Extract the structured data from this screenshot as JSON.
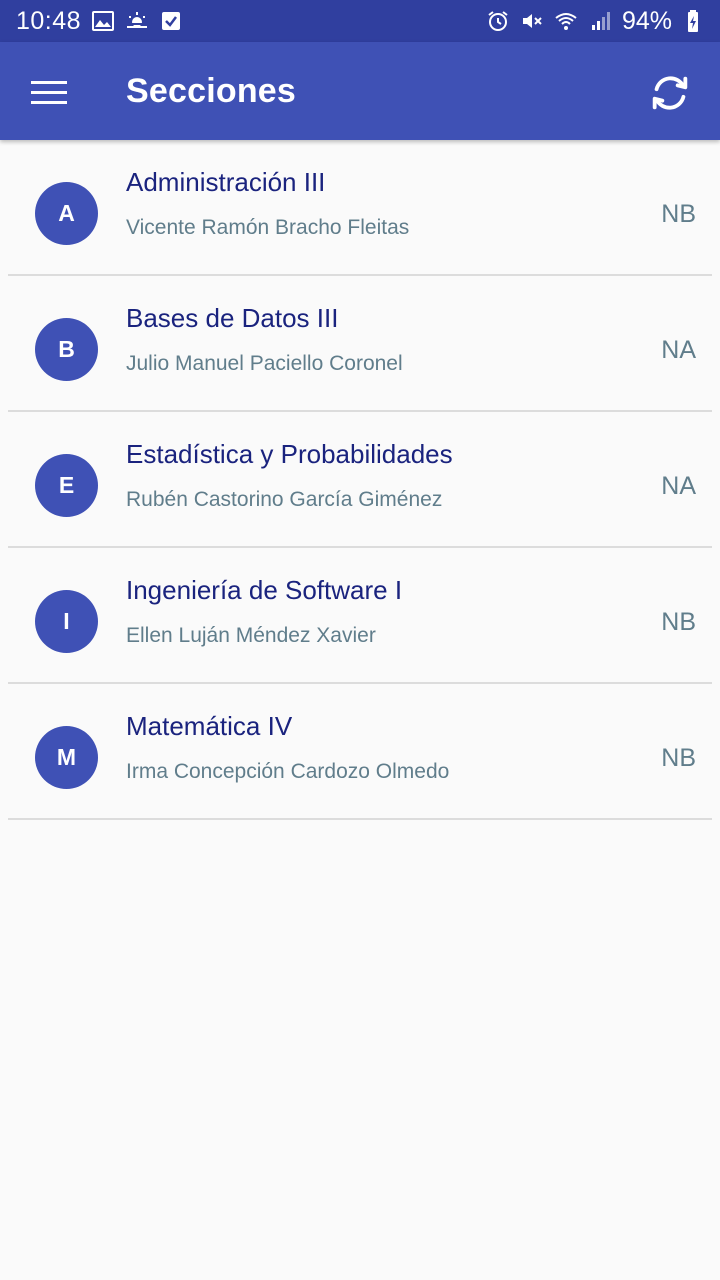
{
  "status_bar": {
    "time": "10:48",
    "battery": "94%",
    "left_icons": [
      "image-icon",
      "weather-icon",
      "checkbox-icon"
    ],
    "right_icons": [
      "alarm-icon",
      "mute-icon",
      "wifi-icon",
      "signal-icon",
      "battery-charging-icon"
    ]
  },
  "app_bar": {
    "title": "Secciones",
    "menu_icon": "hamburger-menu-icon",
    "refresh_icon": "refresh-icon",
    "color": "#3f51b5"
  },
  "colors": {
    "status_bar": "#303f9f",
    "primary": "#3f51b5",
    "title_text": "#1a237e",
    "secondary_text": "#607d8b"
  },
  "sections": [
    {
      "initial": "A",
      "title": "Administración III",
      "teacher": "Vicente Ramón Bracho Fleitas",
      "status": "NB"
    },
    {
      "initial": "B",
      "title": "Bases de Datos III",
      "teacher": "Julio Manuel Paciello Coronel",
      "status": "NA"
    },
    {
      "initial": "E",
      "title": "Estadística y Probabilidades",
      "teacher": "Rubén Castorino García Giménez",
      "status": "NA"
    },
    {
      "initial": "I",
      "title": "Ingeniería de Software I",
      "teacher": "Ellen Luján Méndez Xavier",
      "status": "NB"
    },
    {
      "initial": "M",
      "title": "Matemática IV",
      "teacher": "Irma Concepción Cardozo Olmedo",
      "status": "NB"
    }
  ]
}
